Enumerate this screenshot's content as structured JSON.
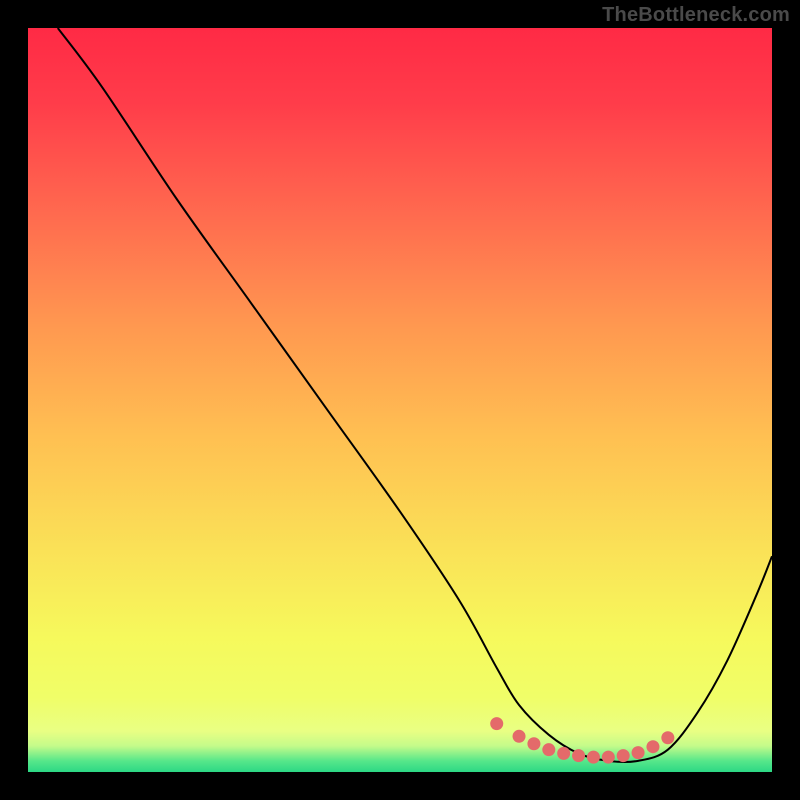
{
  "watermark": "TheBottleneck.com",
  "colors": {
    "frame_bg": "#000000",
    "curve_stroke": "#000000",
    "dot_fill": "#E46A6A",
    "gradient_stops": [
      {
        "offset": 0.0,
        "color": "#FF2A45"
      },
      {
        "offset": 0.1,
        "color": "#FF3C4A"
      },
      {
        "offset": 0.25,
        "color": "#FF6A4F"
      },
      {
        "offset": 0.4,
        "color": "#FF9850"
      },
      {
        "offset": 0.55,
        "color": "#FFC052"
      },
      {
        "offset": 0.7,
        "color": "#FAE157"
      },
      {
        "offset": 0.82,
        "color": "#F6F95C"
      },
      {
        "offset": 0.9,
        "color": "#F0FE68"
      },
      {
        "offset": 0.945,
        "color": "#E9FF83"
      },
      {
        "offset": 0.965,
        "color": "#C4FB8A"
      },
      {
        "offset": 0.985,
        "color": "#57E78A"
      },
      {
        "offset": 1.0,
        "color": "#2CD885"
      }
    ]
  },
  "chart_data": {
    "type": "line",
    "title": "",
    "xlabel": "",
    "ylabel": "",
    "xlim": [
      0,
      100
    ],
    "ylim": [
      0,
      100
    ],
    "grid": false,
    "series": [
      {
        "name": "curve",
        "x": [
          4,
          10,
          20,
          30,
          40,
          50,
          58,
          63,
          66,
          70,
          74,
          78,
          82,
          86,
          90,
          94,
          98,
          100
        ],
        "values": [
          100,
          92,
          77,
          63,
          49,
          35,
          23,
          14,
          9,
          5,
          2.5,
          1.5,
          1.5,
          3,
          8,
          15,
          24,
          29
        ]
      }
    ],
    "highlight_points": {
      "name": "trough-dots",
      "x": [
        63,
        66,
        68,
        70,
        72,
        74,
        76,
        78,
        80,
        82,
        84,
        86
      ],
      "values": [
        6.5,
        4.8,
        3.8,
        3.0,
        2.5,
        2.2,
        2.0,
        2.0,
        2.2,
        2.6,
        3.4,
        4.6
      ]
    }
  }
}
